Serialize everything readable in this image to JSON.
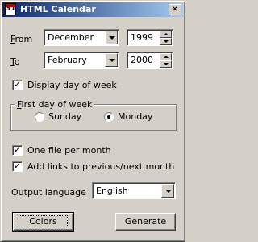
{
  "window": {
    "title": "HTML Calendar",
    "close_symbol": "×",
    "icon_glyph": "31"
  },
  "from": {
    "label_u": "F",
    "label_rest": "rom",
    "month": "December",
    "year": "1999"
  },
  "to": {
    "label_u": "T",
    "label_rest": "o",
    "month": "February",
    "year": "2000"
  },
  "display_day_of_week": {
    "label": "Display day of week",
    "checked": true
  },
  "first_day": {
    "title_u": "F",
    "title_rest": "irst day of week",
    "options": [
      {
        "label": "Sunday",
        "selected": false
      },
      {
        "label": "Monday",
        "selected": true
      }
    ]
  },
  "one_file_per_month": {
    "label": "One file per month",
    "checked": true
  },
  "add_links": {
    "label": "Add links to previous/next month",
    "checked": true
  },
  "output_language": {
    "label": "Output language",
    "value": "English"
  },
  "buttons": {
    "colors": "Colors",
    "generate": "Generate"
  }
}
